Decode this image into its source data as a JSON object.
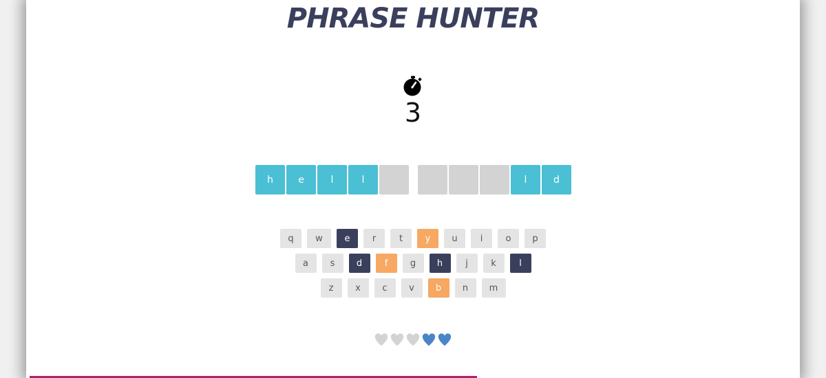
{
  "game": {
    "title": "PHRASE HUNTER"
  },
  "timer": {
    "icon": "stopwatch-icon",
    "value": "3"
  },
  "phrase": {
    "letters": [
      {
        "char": "h",
        "state": "shown"
      },
      {
        "char": "e",
        "state": "shown"
      },
      {
        "char": "l",
        "state": "shown"
      },
      {
        "char": "l",
        "state": "shown"
      },
      {
        "char": "",
        "state": "hidden"
      },
      {
        "char": " ",
        "state": "space"
      },
      {
        "char": "",
        "state": "hidden"
      },
      {
        "char": "",
        "state": "hidden"
      },
      {
        "char": "",
        "state": "hidden"
      },
      {
        "char": "l",
        "state": "shown"
      },
      {
        "char": "d",
        "state": "shown"
      }
    ]
  },
  "keyboard": {
    "rows": [
      [
        {
          "key": "q",
          "state": "unused"
        },
        {
          "key": "w",
          "state": "unused"
        },
        {
          "key": "e",
          "state": "chosen"
        },
        {
          "key": "r",
          "state": "unused"
        },
        {
          "key": "t",
          "state": "unused"
        },
        {
          "key": "y",
          "state": "wrong"
        },
        {
          "key": "u",
          "state": "unused"
        },
        {
          "key": "i",
          "state": "unused"
        },
        {
          "key": "o",
          "state": "unused"
        },
        {
          "key": "p",
          "state": "unused"
        }
      ],
      [
        {
          "key": "a",
          "state": "unused"
        },
        {
          "key": "s",
          "state": "unused"
        },
        {
          "key": "d",
          "state": "chosen"
        },
        {
          "key": "f",
          "state": "wrong"
        },
        {
          "key": "g",
          "state": "unused"
        },
        {
          "key": "h",
          "state": "chosen"
        },
        {
          "key": "j",
          "state": "unused"
        },
        {
          "key": "k",
          "state": "unused"
        },
        {
          "key": "l",
          "state": "chosen"
        }
      ],
      [
        {
          "key": "z",
          "state": "unused"
        },
        {
          "key": "x",
          "state": "unused"
        },
        {
          "key": "c",
          "state": "unused"
        },
        {
          "key": "v",
          "state": "unused"
        },
        {
          "key": "b",
          "state": "wrong"
        },
        {
          "key": "n",
          "state": "unused"
        },
        {
          "key": "m",
          "state": "unused"
        }
      ]
    ]
  },
  "lives": {
    "total": 5,
    "lost": 3,
    "lost_color": "#d3d3d3",
    "live_color": "#4a86c5",
    "icon": "heart-icon"
  },
  "colors": {
    "title": "#3a3f5c",
    "letter_shown": "#4bbfd3",
    "letter_hidden": "#d3d3d3",
    "key_default": "#e4e4e4",
    "key_chosen": "#3a3f5c",
    "key_wrong": "#f7a862",
    "progress_bar": "#b0206e"
  }
}
